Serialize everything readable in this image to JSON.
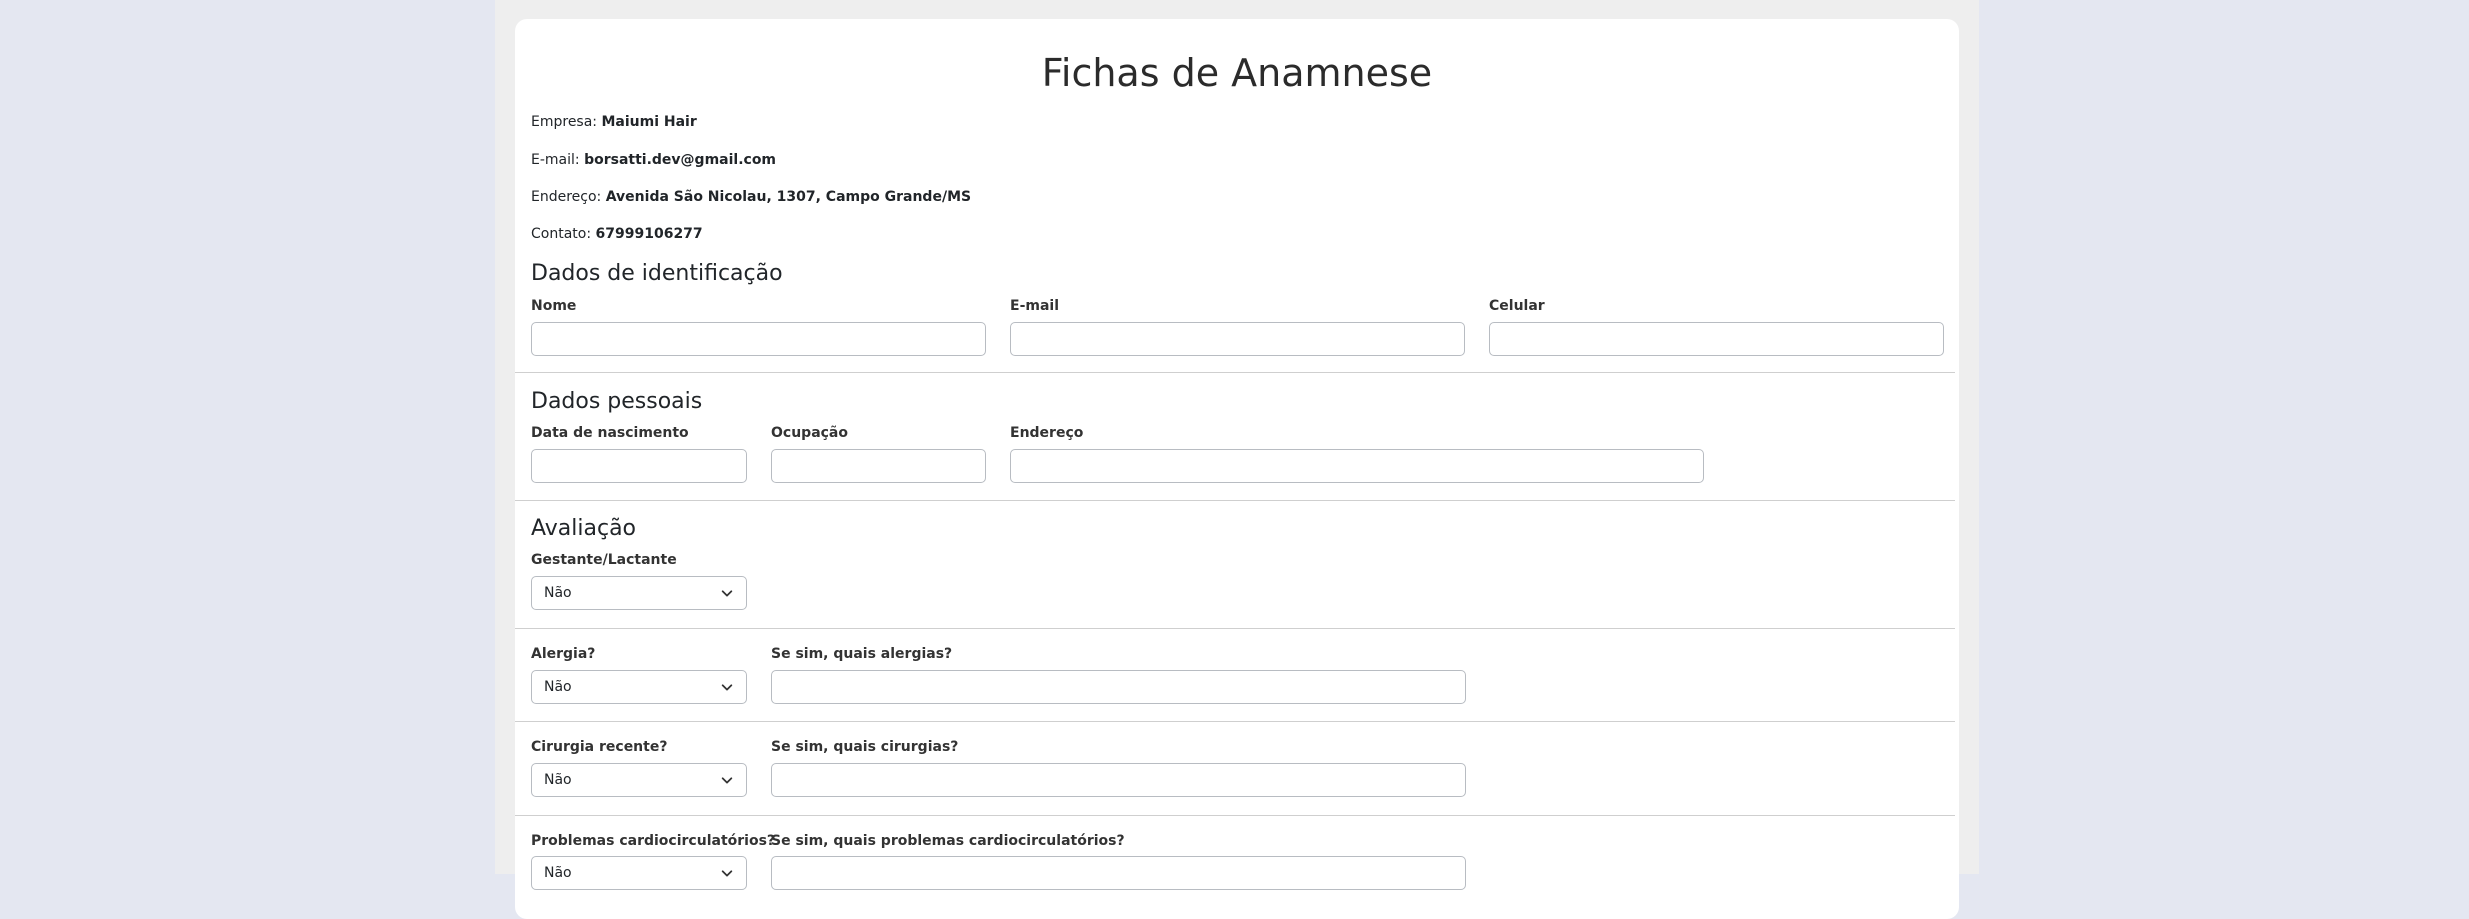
{
  "page": {
    "title": "Fichas de Anamnese"
  },
  "company": {
    "empresa_label": "Empresa:",
    "empresa_value": "Maiumi Hair",
    "email_label": "E-mail:",
    "email_value": "borsatti.dev@gmail.com",
    "endereco_label": "Endereço:",
    "endereco_value": "Avenida São Nicolau, 1307, Campo Grande/MS",
    "contato_label": "Contato:",
    "contato_value": "67999106277"
  },
  "identificacao": {
    "title": "Dados de identificação",
    "nome_label": "Nome",
    "nome_value": "",
    "email_label": "E-mail",
    "email_value": "",
    "celular_label": "Celular",
    "celular_value": ""
  },
  "pessoais": {
    "title": "Dados pessoais",
    "nascimento_label": "Data de nascimento",
    "nascimento_value": "",
    "ocupacao_label": "Ocupação",
    "ocupacao_value": "",
    "endereco_label": "Endereço",
    "endereco_value": ""
  },
  "avaliacao": {
    "title": "Avaliação",
    "gestante_label": "Gestante/Lactante",
    "gestante_value": "Não",
    "alergia_label": "Alergia?",
    "alergia_value": "Não",
    "alergia_detail_label": "Se sim, quais alergias?",
    "alergia_detail_value": "",
    "cirurgia_label": "Cirurgia recente?",
    "cirurgia_value": "Não",
    "cirurgia_detail_label": "Se sim, quais cirurgias?",
    "cirurgia_detail_value": "",
    "cardio_label": "Problemas cardiocirculatórios?",
    "cardio_value": "Não",
    "cardio_detail_label": "Se sim, quais problemas cardiocirculatórios?",
    "cardio_detail_value": ""
  },
  "icons": {
    "select_chevron": "chevron-down-icon"
  }
}
